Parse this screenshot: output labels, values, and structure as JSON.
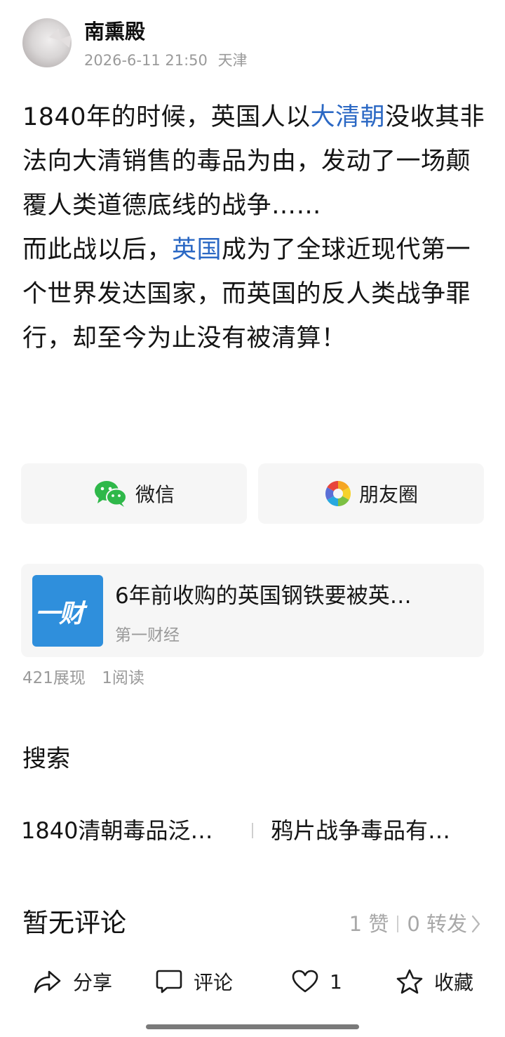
{
  "author": {
    "name": "南熏殿",
    "date": "2026-6-11 21:50",
    "location": "天津"
  },
  "article": {
    "p1_a": "1840年的时候，英国人以",
    "p1_link": "大清朝",
    "p1_b": "没收其非法向大清销售的毒品为由，发动了一场颠覆人类道德底线的战争……",
    "p2_a": "而此战以后，",
    "p2_link": "英国",
    "p2_b": "成为了全球近现代第一个世界发达国家，而英国的反人类战争罪行，却至今为止没有被清算！"
  },
  "share": {
    "wechat_label": "微信",
    "wechat_icon": "wechat-icon",
    "moments_label": "朋友圈",
    "moments_icon": "moments-icon"
  },
  "news_card": {
    "thumb_text": "一财",
    "title": "6年前收购的英国钢铁要被英…",
    "source": "第一财经"
  },
  "stats": {
    "views": "421展现",
    "reads": "1阅读"
  },
  "search": {
    "heading": "搜索",
    "items": [
      "1840清朝毒品泛…",
      "鸦片战争毒品有…"
    ]
  },
  "comments": {
    "heading": "暂无评论",
    "likes": "1 赞",
    "reposts": "0 转发"
  },
  "toolbar": {
    "share_label": "分享",
    "comment_label": "评论",
    "like_count": "1",
    "favorite_label": "收藏"
  },
  "colors": {
    "link": "#2b68c4",
    "card_bg": "#f6f6f6",
    "muted": "#9a9a9a"
  }
}
